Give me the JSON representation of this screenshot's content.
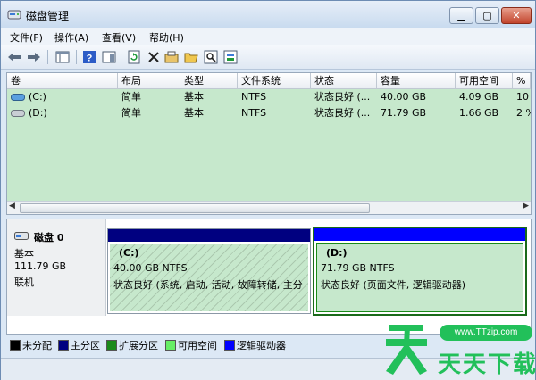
{
  "window": {
    "title": "磁盘管理"
  },
  "menu": [
    "文件(F)",
    "操作(A)",
    "查看(V)",
    "帮助(H)"
  ],
  "table": {
    "headers": [
      "卷",
      "布局",
      "类型",
      "文件系统",
      "状态",
      "容量",
      "可用空间",
      "%"
    ],
    "rows": [
      {
        "volume": "(C:)",
        "layout": "简单",
        "type": "基本",
        "fs": "NTFS",
        "status": "状态良好 (...",
        "capacity": "40.00 GB",
        "free": "4.09 GB",
        "pct": "10"
      },
      {
        "volume": "(D:)",
        "layout": "简单",
        "type": "基本",
        "fs": "NTFS",
        "status": "状态良好 (...",
        "capacity": "71.79 GB",
        "free": "1.66 GB",
        "pct": "2 %"
      }
    ]
  },
  "disk0": {
    "name": "磁盘 0",
    "type": "基本",
    "size": "111.79 GB",
    "state": "联机",
    "partitions": [
      {
        "name": "(C:)",
        "size_fs": "40.00 GB NTFS",
        "status": "状态良好 (系统, 启动, 活动, 故障转储, 主分"
      },
      {
        "name": "(D:)",
        "size_fs": "71.79 GB NTFS",
        "status": "状态良好 (页面文件, 逻辑驱动器)"
      }
    ]
  },
  "legend": [
    {
      "label": "未分配",
      "color": "#000000"
    },
    {
      "label": "主分区",
      "color": "#000080"
    },
    {
      "label": "扩展分区",
      "color": "#1a8a1a"
    },
    {
      "label": "可用空间",
      "color": "#66ee66"
    },
    {
      "label": "逻辑驱动器",
      "color": "#0000ff"
    }
  ],
  "watermark": {
    "url": "www.TTzip.com",
    "brand": "天天下载"
  },
  "colors": {
    "primary_bar": "#000080",
    "logical_bar": "#0000ff",
    "partition_fill": "#c6e8cc",
    "brand_green": "#22c05a"
  }
}
